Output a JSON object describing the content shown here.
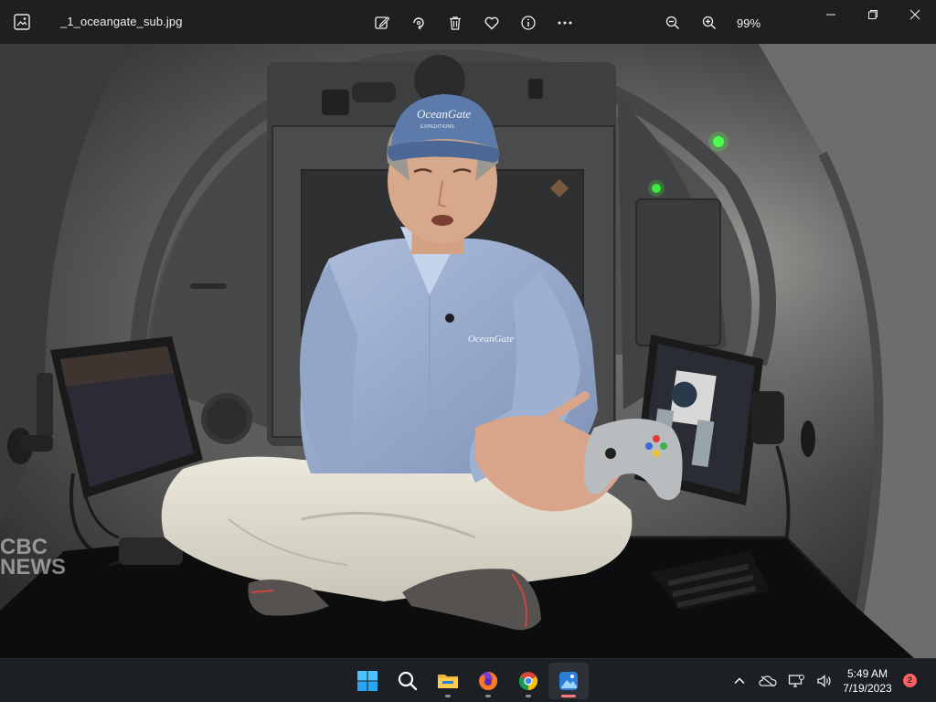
{
  "window": {
    "filename": "_1_oceangate_sub.jpg",
    "zoom_level": "99%",
    "toolbar_icons": [
      "edit-image-icon",
      "rotate-icon",
      "delete-icon",
      "favorite-icon",
      "info-icon",
      "more-icon"
    ],
    "zoom_icons": [
      "zoom-out-icon",
      "zoom-in-icon"
    ],
    "window_controls": [
      "minimize-icon",
      "maximize-icon",
      "close-icon"
    ]
  },
  "image": {
    "watermark_line1": "CBC",
    "watermark_line2": "NEWS",
    "cap_logo": "OceanGate",
    "cap_logo_sub": "EXPEDITIONS",
    "shirt_logo": "OceanGate"
  },
  "taskbar": {
    "apps": [
      "windows-start-icon",
      "search-icon",
      "file-explorer-icon",
      "firefox-icon",
      "chrome-icon",
      "photos-icon"
    ],
    "tray_icons": [
      "chevron-up-icon",
      "onedrive-icon",
      "network-icon",
      "volume-icon"
    ],
    "clock_time": "5:49 AM",
    "clock_date": "7/19/2023",
    "notification_count": "2"
  },
  "colors": {
    "titlebar_bg": "#1f1f1f",
    "taskbar_bg": "#1c1f24",
    "notification_badge": "#ff6161",
    "active_indicator": "#ff7b7b"
  }
}
